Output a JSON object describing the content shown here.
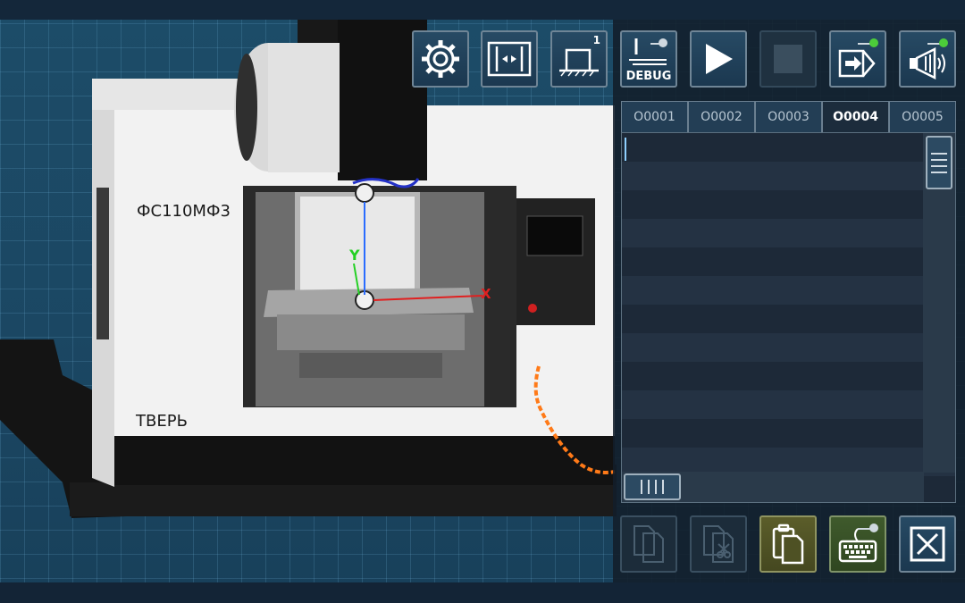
{
  "machine": {
    "model_label": "ФС110МФ3",
    "city_label": "ТВЕРЬ",
    "axis_y": "Y",
    "axis_x": "X"
  },
  "toolbar": {
    "workpiece_count": "1",
    "debug_label": "DEBUG"
  },
  "program_tabs": [
    "O0001",
    "O0002",
    "O0003",
    "O0004",
    "O0005"
  ],
  "active_tab": "O0004",
  "colors": {
    "accent_green": "#4ccd3a",
    "panel": "#1c2c3c",
    "button": "#274a64"
  },
  "icons": {
    "settings": "gear-icon",
    "fixture": "fixture-icon",
    "workpiece": "workpiece-icon",
    "debug": "debug-icon",
    "run": "play-icon",
    "stop": "stop-icon",
    "input": "input-icon",
    "sound": "megaphone-icon",
    "copy": "copy-icon",
    "cut": "cut-icon",
    "paste": "paste-icon",
    "keyboard": "keyboard-icon",
    "close": "close-icon"
  }
}
